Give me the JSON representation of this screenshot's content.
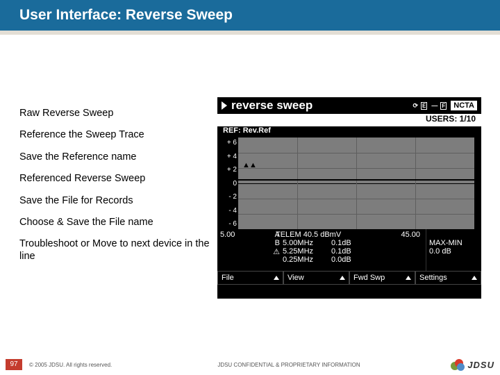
{
  "header": {
    "title": "User Interface:  Reverse Sweep"
  },
  "steps": [
    "Raw Reverse Sweep",
    "Reference the Sweep Trace",
    "Save the Reference name",
    "Referenced Reverse Sweep",
    "Save the File for Records",
    "Choose & Save the File name",
    "Troubleshoot or Move to next device in the line"
  ],
  "device": {
    "title": "reverse sweep",
    "linkE": "E",
    "linkF": "F",
    "badge": "NCTA",
    "users": "USERS:  1/10",
    "ref": "REF:  Rev.Ref",
    "yticks": [
      "+ 6",
      "+ 4",
      "+ 2",
      "0",
      "- 2",
      "- 4",
      "- 6"
    ],
    "startFreq": "5.00",
    "telem": "TELEM 40.5 dBmV",
    "endFreq": "45.00",
    "rowsL": [
      "A",
      "B",
      "⚠"
    ],
    "rowsF": [
      "5.00MHz",
      "5.25MHz",
      "0.25MHz"
    ],
    "rowsD": [
      "0.1dB",
      "0.1dB",
      "0.0dB"
    ],
    "maxmin": "MAX-MIN",
    "maxminv": "0.0 dB",
    "softkeys": [
      "File",
      "View",
      "Fwd Swp",
      "Settings"
    ]
  },
  "footer": {
    "page": "97",
    "copyright": "© 2005 JDSU. All rights reserved.",
    "confidential": "JDSU CONFIDENTIAL & PROPRIETARY INFORMATION",
    "logo": "JDSU"
  }
}
